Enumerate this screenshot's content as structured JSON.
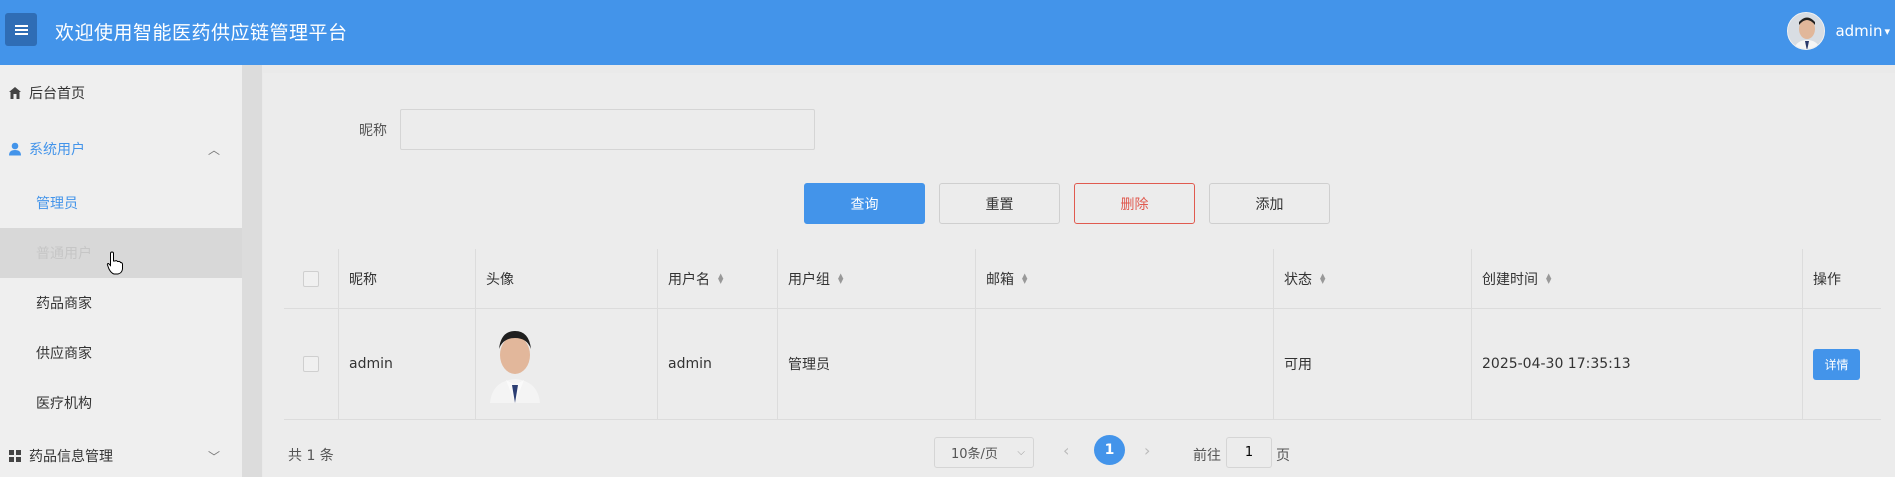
{
  "header": {
    "title": "欢迎使用智能医药供应链管理平台",
    "user_name": "admin",
    "colors": {
      "bar": "#4394ea",
      "toggle": "#2f6db5"
    }
  },
  "sidebar": {
    "items": [
      {
        "label": "后台首页",
        "icon": "home-icon"
      },
      {
        "label": "系统用户",
        "icon": "user-icon",
        "expanded": true
      },
      {
        "label": "管理员",
        "active": true
      },
      {
        "label": "普通用户",
        "hovered": true
      },
      {
        "label": "药品商家"
      },
      {
        "label": "供应商家"
      },
      {
        "label": "医疗机构"
      },
      {
        "label": "药品信息管理",
        "icon": "grid-icon",
        "expanded": false
      }
    ]
  },
  "search": {
    "label": "昵称",
    "value": ""
  },
  "buttons": {
    "query": "查询",
    "reset": "重置",
    "delete": "删除",
    "add": "添加"
  },
  "table": {
    "headers": [
      "昵称",
      "头像",
      "用户名",
      "用户组",
      "邮箱",
      "状态",
      "创建时间",
      "操作"
    ],
    "rows": [
      {
        "nickname": "admin",
        "username": "admin",
        "group": "管理员",
        "email": "",
        "status": "可用",
        "created": "2025-04-30 17:35:13",
        "action": "详情"
      }
    ]
  },
  "pagination": {
    "total": "共 1 条",
    "page_size": "10条/页",
    "current": "1",
    "goto_label": "前往",
    "goto_value": "1",
    "goto_suffix": "页"
  }
}
